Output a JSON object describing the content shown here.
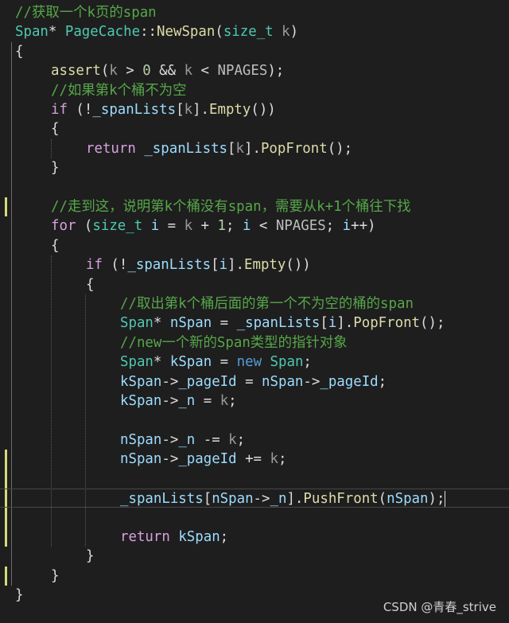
{
  "watermark": "CSDN @青春_strive",
  "colors": {
    "background": "#1e1e1e",
    "comment": "#57a64a",
    "keyword": "#569cd6",
    "control": "#d8a0df",
    "type": "#4ec9b0",
    "function": "#dcdcaa",
    "variable": "#9cdcfe",
    "macro": "#bebebe",
    "number": "#b5cea8",
    "change-bar": "#d7d97a"
  },
  "code": {
    "lines": [
      [
        [
          "comment",
          "//获取一个k页的span"
        ]
      ],
      [
        [
          "type",
          "Span"
        ],
        [
          "punc",
          "* "
        ],
        [
          "type",
          "PageCache"
        ],
        [
          "punc",
          "::"
        ],
        [
          "fn",
          "NewSpan"
        ],
        [
          "punc",
          "("
        ],
        [
          "type",
          "size_t"
        ],
        [
          "punc",
          " "
        ],
        [
          "param",
          "k"
        ],
        [
          "punc",
          ")"
        ]
      ],
      [
        [
          "punc",
          "{"
        ]
      ],
      [
        [
          "fn",
          "assert"
        ],
        [
          "punc",
          "("
        ],
        [
          "param",
          "k"
        ],
        [
          "punc",
          " > "
        ],
        [
          "num",
          "0"
        ],
        [
          "punc",
          " && "
        ],
        [
          "param",
          "k"
        ],
        [
          "punc",
          " < "
        ],
        [
          "macro",
          "NPAGES"
        ],
        [
          "punc",
          ");"
        ]
      ],
      [
        [
          "comment",
          "//如果第k个桶不为空"
        ]
      ],
      [
        [
          "ctrl",
          "if"
        ],
        [
          "punc",
          " (!"
        ],
        [
          "var",
          "_spanLists"
        ],
        [
          "punc",
          "["
        ],
        [
          "param",
          "k"
        ],
        [
          "punc",
          "]."
        ],
        [
          "fn",
          "Empty"
        ],
        [
          "punc",
          "())"
        ]
      ],
      [
        [
          "punc",
          "{"
        ]
      ],
      [
        [
          "ctrl",
          "return"
        ],
        [
          "punc",
          " "
        ],
        [
          "var",
          "_spanLists"
        ],
        [
          "punc",
          "["
        ],
        [
          "param",
          "k"
        ],
        [
          "punc",
          "]."
        ],
        [
          "fn",
          "PopFront"
        ],
        [
          "punc",
          "();"
        ]
      ],
      [
        [
          "punc",
          "}"
        ]
      ],
      [],
      [
        [
          "comment",
          "//走到这，说明第k个桶没有span，需要从k+1个桶往下找"
        ]
      ],
      [
        [
          "ctrl",
          "for"
        ],
        [
          "punc",
          " ("
        ],
        [
          "type",
          "size_t"
        ],
        [
          "punc",
          " "
        ],
        [
          "var",
          "i"
        ],
        [
          "punc",
          " = "
        ],
        [
          "param",
          "k"
        ],
        [
          "punc",
          " + "
        ],
        [
          "num",
          "1"
        ],
        [
          "punc",
          "; "
        ],
        [
          "var",
          "i"
        ],
        [
          "punc",
          " < "
        ],
        [
          "macro",
          "NPAGES"
        ],
        [
          "punc",
          "; "
        ],
        [
          "var",
          "i"
        ],
        [
          "punc",
          "++)"
        ]
      ],
      [
        [
          "punc",
          "{"
        ]
      ],
      [
        [
          "ctrl",
          "if"
        ],
        [
          "punc",
          " (!"
        ],
        [
          "var",
          "_spanLists"
        ],
        [
          "punc",
          "["
        ],
        [
          "var",
          "i"
        ],
        [
          "punc",
          "]."
        ],
        [
          "fn",
          "Empty"
        ],
        [
          "punc",
          "())"
        ]
      ],
      [
        [
          "punc",
          "{"
        ]
      ],
      [
        [
          "comment",
          "//取出第k个桶后面的第一个不为空的桶的span"
        ]
      ],
      [
        [
          "type",
          "Span"
        ],
        [
          "punc",
          "* "
        ],
        [
          "var",
          "nSpan"
        ],
        [
          "punc",
          " = "
        ],
        [
          "var",
          "_spanLists"
        ],
        [
          "punc",
          "["
        ],
        [
          "var",
          "i"
        ],
        [
          "punc",
          "]."
        ],
        [
          "fn",
          "PopFront"
        ],
        [
          "punc",
          "();"
        ]
      ],
      [
        [
          "comment",
          "//new一个新的Span类型的指针对象"
        ]
      ],
      [
        [
          "type",
          "Span"
        ],
        [
          "punc",
          "* "
        ],
        [
          "var",
          "kSpan"
        ],
        [
          "punc",
          " = "
        ],
        [
          "kw",
          "new"
        ],
        [
          "punc",
          " "
        ],
        [
          "type",
          "Span"
        ],
        [
          "punc",
          ";"
        ]
      ],
      [
        [
          "var",
          "kSpan"
        ],
        [
          "punc",
          "->"
        ],
        [
          "var",
          "_pageId"
        ],
        [
          "punc",
          " = "
        ],
        [
          "var",
          "nSpan"
        ],
        [
          "punc",
          "->"
        ],
        [
          "var",
          "_pageId"
        ],
        [
          "punc",
          ";"
        ]
      ],
      [
        [
          "var",
          "kSpan"
        ],
        [
          "punc",
          "->"
        ],
        [
          "var",
          "_n"
        ],
        [
          "punc",
          " = "
        ],
        [
          "param",
          "k"
        ],
        [
          "punc",
          ";"
        ]
      ],
      [],
      [
        [
          "var",
          "nSpan"
        ],
        [
          "punc",
          "->"
        ],
        [
          "var",
          "_n"
        ],
        [
          "punc",
          " -= "
        ],
        [
          "param",
          "k"
        ],
        [
          "punc",
          ";"
        ]
      ],
      [
        [
          "var",
          "nSpan"
        ],
        [
          "punc",
          "->"
        ],
        [
          "var",
          "_pageId"
        ],
        [
          "punc",
          " += "
        ],
        [
          "param",
          "k"
        ],
        [
          "punc",
          ";"
        ]
      ],
      [],
      [
        [
          "var",
          "_spanLists"
        ],
        [
          "punc",
          "["
        ],
        [
          "var",
          "nSpan"
        ],
        [
          "punc",
          "->"
        ],
        [
          "var",
          "_n"
        ],
        [
          "punc",
          "]."
        ],
        [
          "fn",
          "PushFront"
        ],
        [
          "punc",
          "("
        ],
        [
          "var",
          "nSpan"
        ],
        [
          "punc",
          ");"
        ]
      ],
      [],
      [
        [
          "ctrl",
          "return"
        ],
        [
          "punc",
          " "
        ],
        [
          "var",
          "kSpan"
        ],
        [
          "punc",
          ";"
        ]
      ],
      [
        [
          "punc",
          "}"
        ]
      ],
      [
        [
          "punc",
          "}"
        ]
      ],
      [
        [
          "punc",
          "}"
        ]
      ]
    ]
  }
}
